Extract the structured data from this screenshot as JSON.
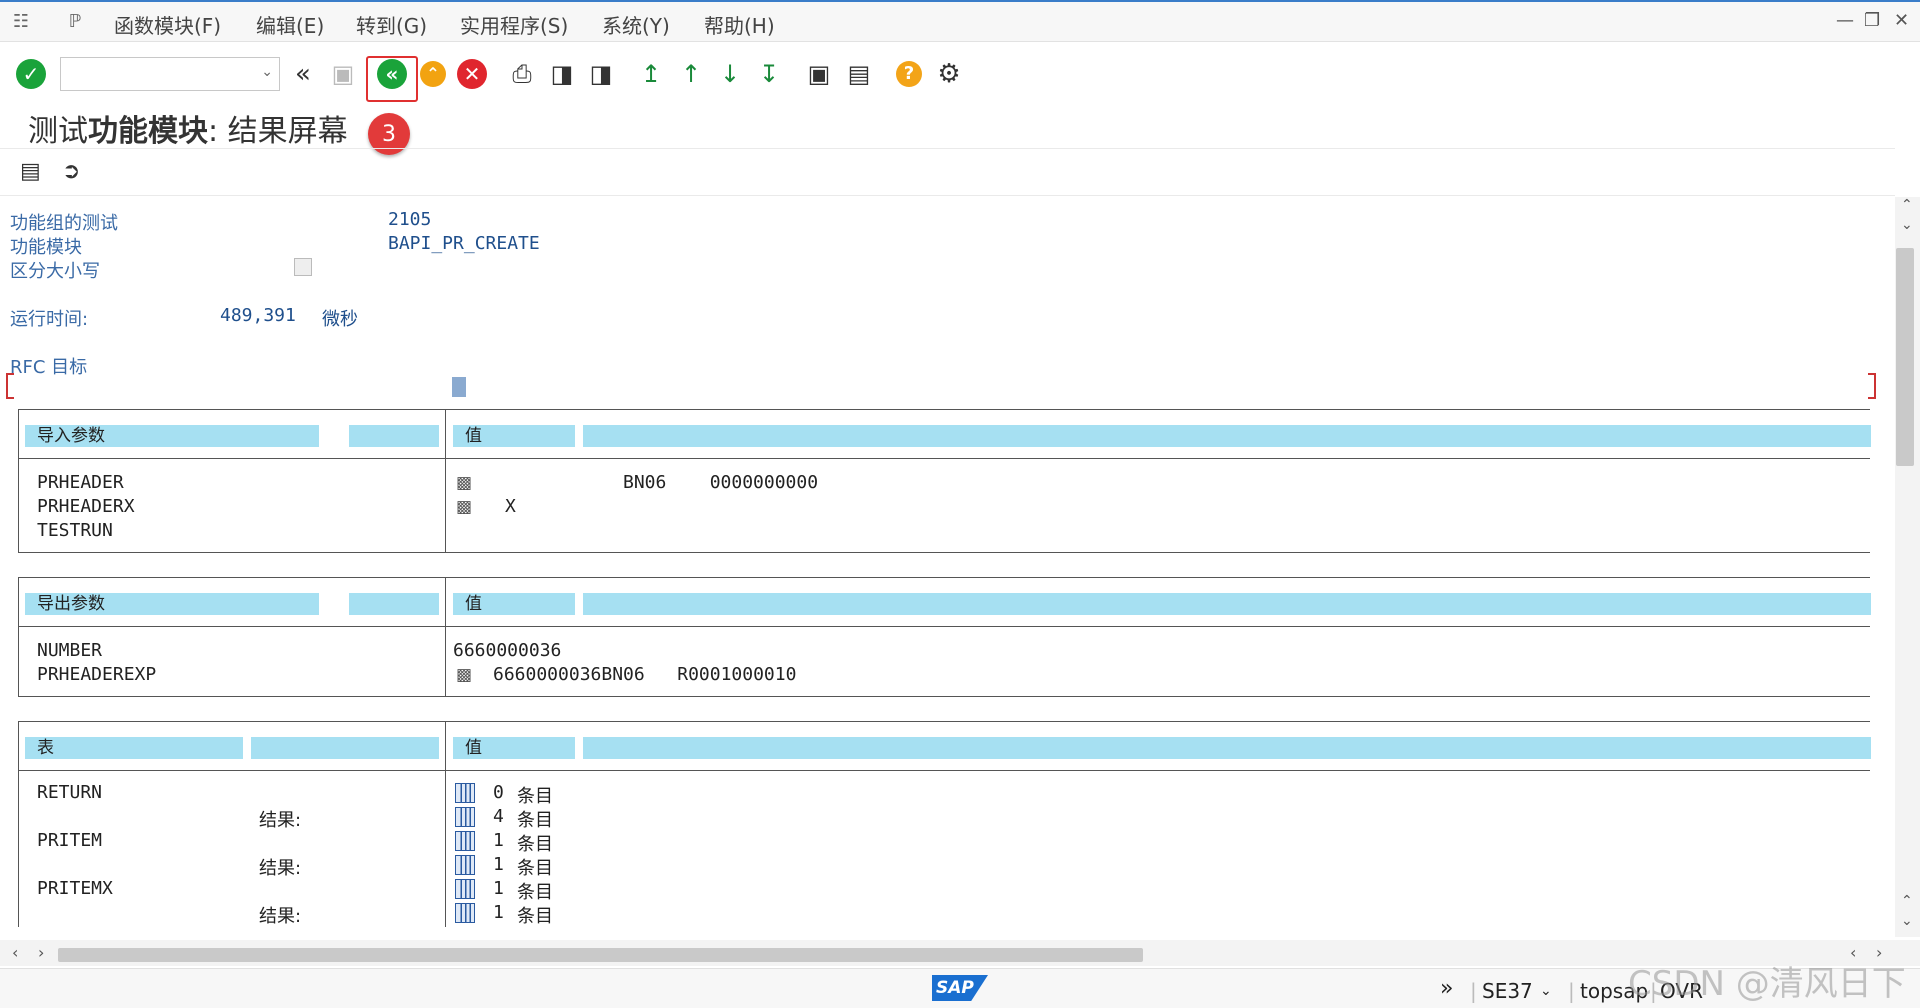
{
  "menubar": {
    "items": [
      "函数模块(F)",
      "编辑(E)",
      "转到(G)",
      "实用程序(S)",
      "系统(Y)",
      "帮助(H)"
    ]
  },
  "toolbar": {
    "buttons": [
      "enter-icon",
      "back-icon",
      "save-icon",
      "back-green-icon",
      "exit-icon",
      "cancel-icon",
      "print-icon",
      "find-icon",
      "find-next-icon",
      "first-page-icon",
      "prev-page-icon",
      "next-page-icon",
      "last-page-icon",
      "new-session-icon",
      "shortcut-icon",
      "help-icon",
      "settings-icon"
    ],
    "badge": "3",
    "colors": {
      "green": "#1aa33a",
      "orange": "#f2a311",
      "red": "#e0262e",
      "help": "#f3a418"
    }
  },
  "title": {
    "prefix": "测试",
    "bold": "功能模块",
    "suffix": ": 结果屏幕"
  },
  "info": {
    "group_label": "功能组的测试",
    "group_value": "2105",
    "fm_label": "功能模块",
    "fm_value": "BAPI_PR_CREATE",
    "case_label": "区分大小写",
    "runtime_label": "运行时间:",
    "runtime_value": "489,391",
    "runtime_unit": "微秒",
    "rfc_label": "RFC 目标"
  },
  "import_section": {
    "header": "导入参数",
    "value_header": "值",
    "params": [
      "PRHEADER",
      "PRHEADERX",
      "TESTRUN"
    ],
    "values": [
      "BN06    0000000000",
      "X"
    ]
  },
  "export_section": {
    "header": "导出参数",
    "value_header": "值",
    "params": [
      "NUMBER",
      "PRHEADEREXP"
    ],
    "values": [
      "6660000036",
      "6660000036BN06   R0001000010"
    ]
  },
  "tables_section": {
    "header": "表",
    "value_header": "值",
    "rows": [
      {
        "name": "RETURN",
        "result_label": "结果:",
        "count1": "0",
        "count2": "4",
        "unit": "条目"
      },
      {
        "name": "PRITEM",
        "result_label": "结果:",
        "count1": "1",
        "count2": "1",
        "unit": "条目"
      },
      {
        "name": "PRITEMX",
        "result_label": "结果:",
        "count1": "1",
        "count2": "1",
        "unit": "条目"
      }
    ]
  },
  "statusbar": {
    "sap_logo": "SAP",
    "tcode": "SE37",
    "user": "topsap",
    "mode": "OVR",
    "watermark": "CSDN @清风日下"
  }
}
